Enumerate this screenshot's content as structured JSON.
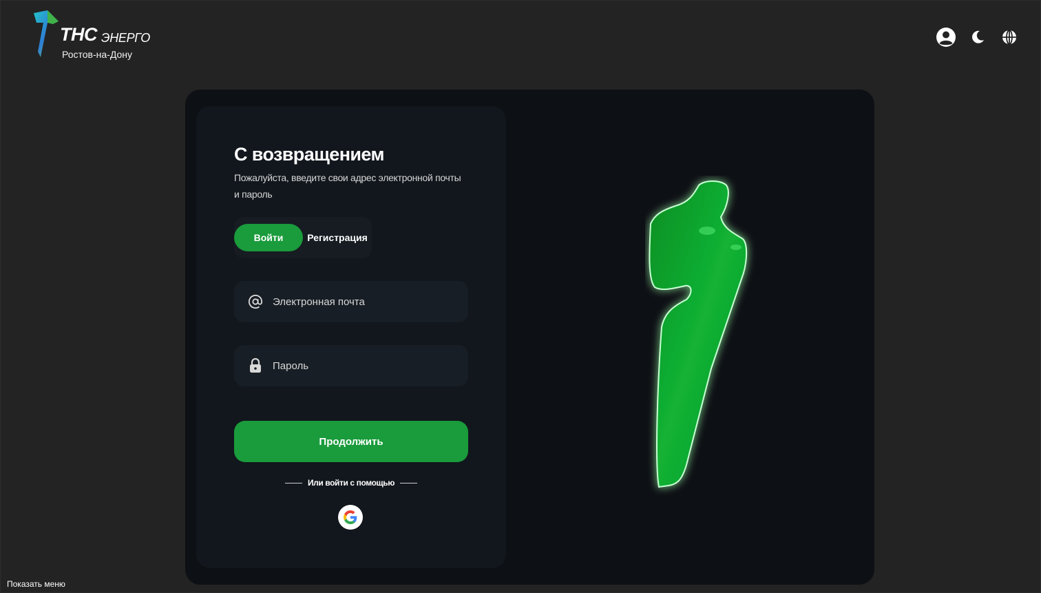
{
  "header": {
    "logo": {
      "brand": "ТНС",
      "suffix": "ЭНЕРГО",
      "city": "Ростов-на-Дону"
    },
    "icons": [
      "user-icon",
      "moon-icon",
      "globe-icon"
    ]
  },
  "login": {
    "title": "С возвращением",
    "subtitle": "Пожалуйста, введите свои адрес электронной почты и пароль",
    "tabs": [
      {
        "label": "Войти",
        "active": true
      },
      {
        "label": "Регистрация",
        "active": false
      }
    ],
    "email": {
      "placeholder": "Электронная почта",
      "value": ""
    },
    "password": {
      "placeholder": "Пароль",
      "value": ""
    },
    "continue_label": "Продолжить",
    "alt_login_label": "Или войти с помощью",
    "social": [
      "google-icon"
    ]
  },
  "footer": {
    "show_menu_label": "Показать меню"
  },
  "colors": {
    "accent": "#1a9b3c",
    "background": "#232323",
    "card": "#0d1014",
    "panel": "#12171d",
    "glow": "#1fd64a"
  }
}
